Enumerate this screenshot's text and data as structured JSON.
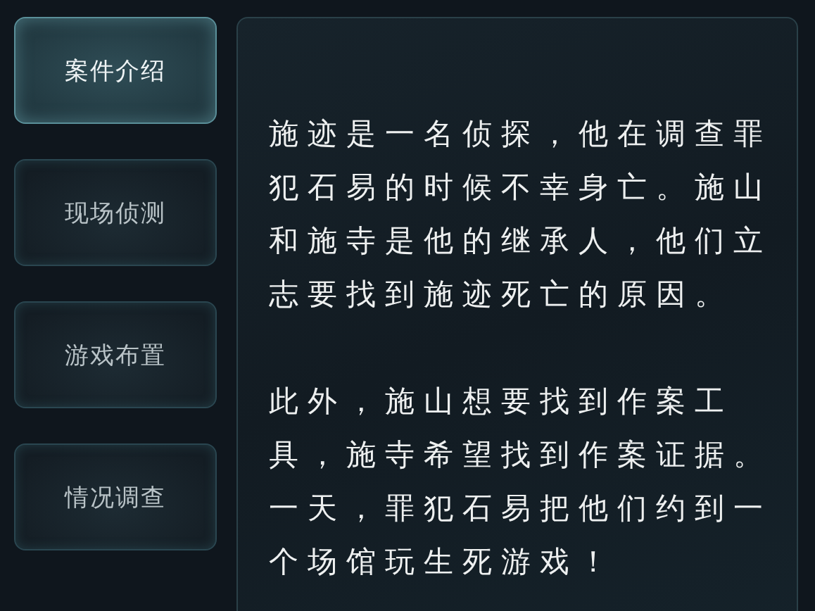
{
  "sidebar": {
    "items": [
      {
        "label": "案件介绍",
        "selected": true
      },
      {
        "label": "现场侦测",
        "selected": false
      },
      {
        "label": "游戏布置",
        "selected": false
      },
      {
        "label": "情况调查",
        "selected": false
      }
    ]
  },
  "panel": {
    "paragraphs": [
      "施迹是一名侦探，他在调查罪犯石易的时候不幸身亡。施山和施寺是他的继承人，他们立志要找到施迹死亡的原因。",
      "此外，施山想要找到作案工具，施寺希望找到作案证据。一天，罪犯石易把他们约到一个场馆玩生死游戏！"
    ]
  }
}
